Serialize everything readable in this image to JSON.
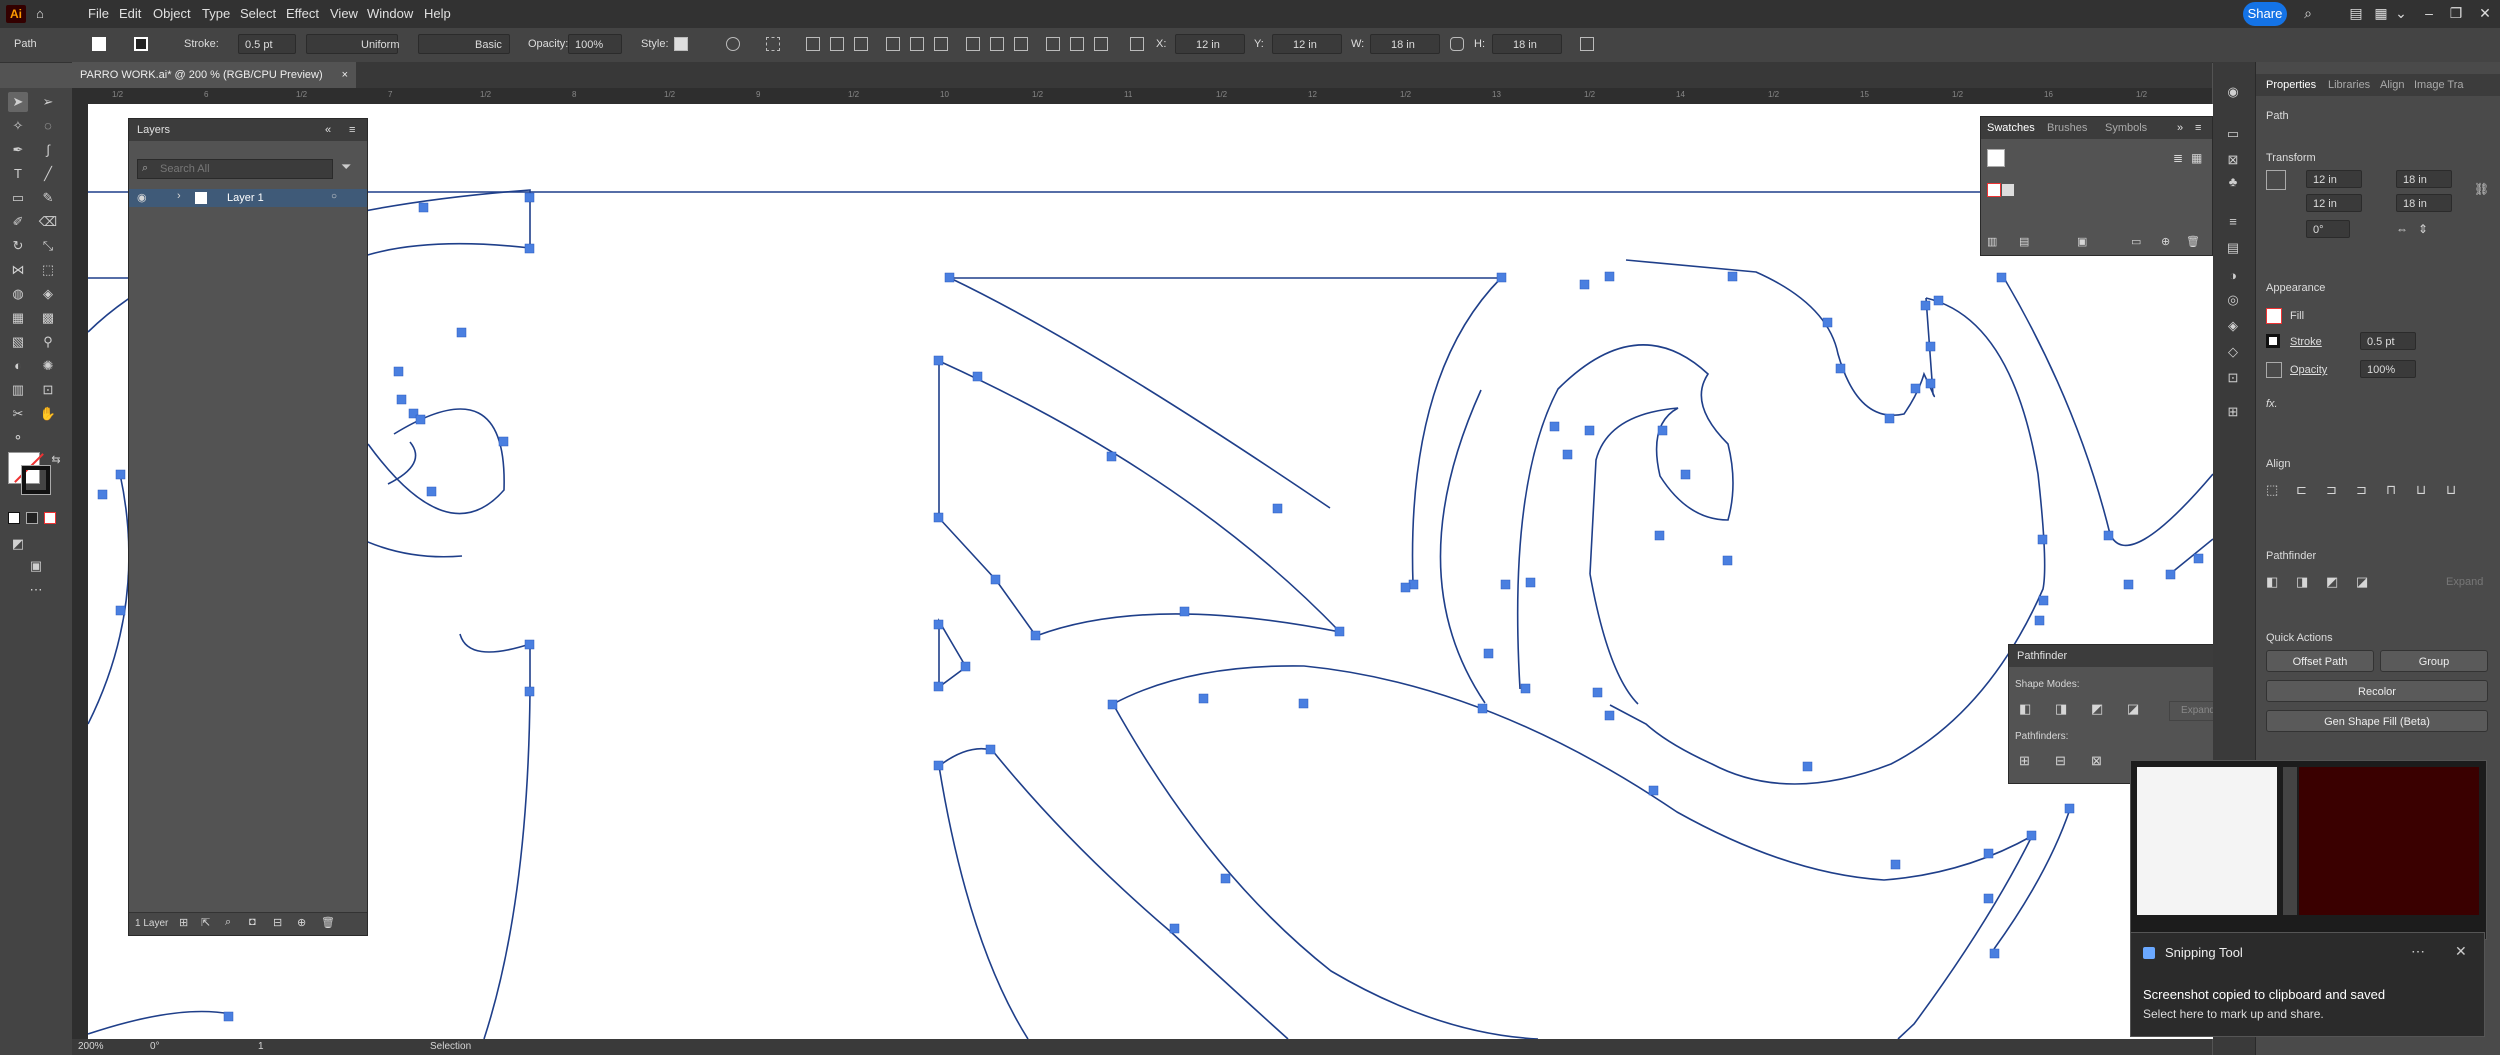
{
  "app": {
    "logo": "Ai",
    "share_label": "Share"
  },
  "menu": [
    "File",
    "Edit",
    "Object",
    "Type",
    "Select",
    "Effect",
    "View",
    "Window",
    "Help"
  ],
  "control_bar": {
    "selection_type": "Path",
    "stroke_label": "Stroke:",
    "stroke_value": "0.5 pt",
    "profile_uniform": "Uniform",
    "brush_basic": "Basic",
    "opacity_label": "Opacity:",
    "opacity_value": "100%",
    "style_label": "Style:",
    "x_label": "X:",
    "x_value": "12 in",
    "y_label": "Y:",
    "y_value": "12 in",
    "w_label": "W:",
    "w_value": "18 in",
    "h_label": "H:",
    "h_value": "18 in"
  },
  "document": {
    "tab_title": "PARRO WORK.ai* @ 200 % (RGB/CPU Preview)",
    "close": "×"
  },
  "ruler_marks": [
    "1/2",
    "6",
    "1/2",
    "7",
    "1/2",
    "8",
    "1/2",
    "9",
    "1/2",
    "10",
    "1/2",
    "11",
    "1/2",
    "12",
    "1/2",
    "13",
    "1/2",
    "14",
    "1/2",
    "15",
    "1/2",
    "16",
    "1/2"
  ],
  "layers_panel": {
    "title": "Layers",
    "search_placeholder": "Search All",
    "layer_name": "Layer 1",
    "footer_count": "1 Layer"
  },
  "swatches_panel": {
    "tabs": [
      "Swatches",
      "Brushes",
      "Symbols"
    ]
  },
  "pathfinder_panel": {
    "title": "Pathfinder",
    "shape_modes": "Shape Modes:",
    "pathfinders": "Pathfinders:",
    "expand": "Expand"
  },
  "properties_panel": {
    "tabs": [
      "Properties",
      "Libraries",
      "Align",
      "Image Tra"
    ],
    "selection": "Path",
    "transform_title": "Transform",
    "x_value": "12 in",
    "y_value": "12 in",
    "w_value": "18 in",
    "h_value": "18 in",
    "angle_value": "0°",
    "appearance_title": "Appearance",
    "fill_label": "Fill",
    "stroke_label": "Stroke",
    "stroke_value": "0.5 pt",
    "opacity_label": "Opacity",
    "opacity_value": "100%",
    "fx_label": "fx.",
    "align_title": "Align",
    "pathfinder_title": "Pathfinder",
    "expand": "Expand",
    "quick_actions_title": "Quick Actions",
    "offset_path": "Offset Path",
    "group": "Group",
    "recolor": "Recolor",
    "gen_shape_fill": "Gen Shape Fill (Beta)"
  },
  "status_bar": {
    "zoom": "200%",
    "rotation": "0°",
    "artboard": "1",
    "tool": "Selection"
  },
  "notification": {
    "app": "Snipping Tool",
    "message": "Screenshot copied to clipboard and saved",
    "sub": "Select here to mark up and share."
  },
  "colors": {
    "accent": "#1473e6",
    "anchor": "#4a7fe0",
    "path": "#1f3f8a"
  }
}
